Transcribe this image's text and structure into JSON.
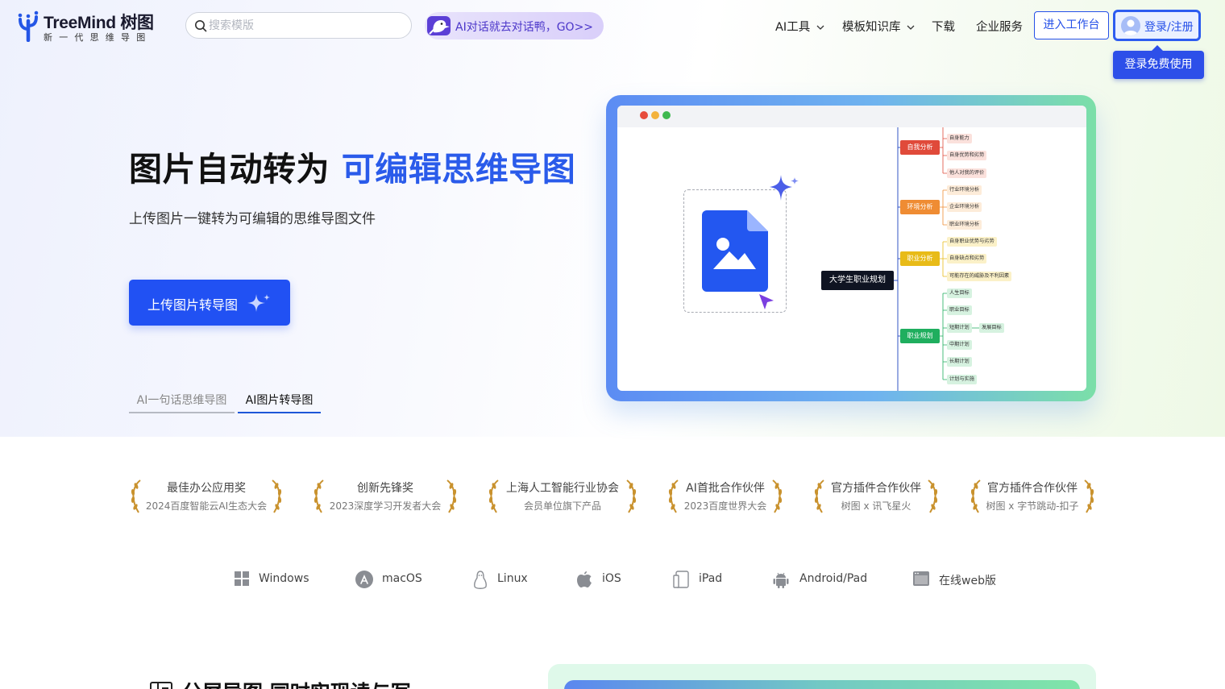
{
  "header": {
    "logo_name": "TreeMind 树图",
    "logo_tagline": "新一代思维导图",
    "search_placeholder": "搜索模版",
    "ai_banner": "AI对话就去对话鸭，GO>>",
    "nav": [
      "AI工具",
      "模板知识库",
      "下载",
      "企业服务"
    ],
    "workspace_button": "进入工作台",
    "login_button": "登录/注册",
    "login_tooltip": "登录免费使用"
  },
  "hero": {
    "title_plain": "图片自动转为 ",
    "title_highlight": "可编辑思维导图",
    "subtitle": "上传图片一键转为可编辑的思维导图文件",
    "upload_button": "上传图片转导图",
    "tabs": [
      "AI一句话思维导图",
      "AI图片转导图"
    ],
    "active_tab": "AI图片转导图"
  },
  "preview": {
    "root": "大学生职业规划",
    "branches": [
      {
        "label": "自我分析",
        "color": "#e04a3a",
        "leaves": [
          "自身能力",
          "自身优势和劣势",
          "他人对我的评价"
        ]
      },
      {
        "label": "环境分析",
        "color": "#ef8c33",
        "leaves": [
          "行业环境分析",
          "企业环境分析",
          "职业环境分析"
        ]
      },
      {
        "label": "职业分析",
        "color": "#e8bb18",
        "leaves": [
          "自身职业优势与劣势",
          "自身缺点和劣势",
          "可能存在的威胁及不利因素"
        ]
      },
      {
        "label": "职业规划",
        "color": "#1fae5e",
        "leaves": [
          "人生目标",
          "职业目标",
          "短期计划",
          "中期计划",
          "长期计划",
          "计划与实施"
        ],
        "sub_leaf": "发展目标"
      }
    ]
  },
  "awards": [
    {
      "title": "最佳办公应用奖",
      "subtitle": "2024百度智能云AI生态大会"
    },
    {
      "title": "创新先锋奖",
      "subtitle": "2023深度学习开发者大会"
    },
    {
      "title": "上海人工智能行业协会",
      "subtitle": "会员单位旗下产品"
    },
    {
      "title": "AI首批合作伙伴",
      "subtitle": "2023百度世界大会"
    },
    {
      "title": "官方插件合作伙伴",
      "subtitle": "树图 x 讯飞星火"
    },
    {
      "title": "官方插件合作伙伴",
      "subtitle": "树图 x 字节跳动-扣子"
    }
  ],
  "platforms": [
    "Windows",
    "macOS",
    "Linux",
    "iOS",
    "iPad",
    "Android/Pad",
    "在线web版"
  ],
  "bottom": {
    "section_title": "分屏导图 同时实现读与写"
  },
  "colors": {
    "brand_blue": "#2151f3",
    "highlight_blue": "#2a5bea",
    "laurel_gold": "#c9922e"
  }
}
